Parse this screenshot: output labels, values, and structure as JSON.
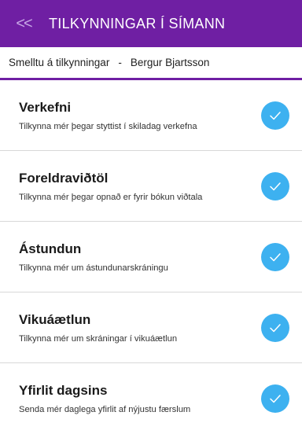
{
  "header": {
    "back_glyph": "<<",
    "title": "TILKYNNINGAR Í SÍMANN"
  },
  "subheader": {
    "instruction": "Smelltu á tilkynningar",
    "separator": "-",
    "user_name": "Bergur Bjartsson"
  },
  "colors": {
    "brand": "#6f1fa3",
    "check": "#3db1f0"
  },
  "items": [
    {
      "title": "Verkefni",
      "description": "Tilkynna mér þegar styttist í skiladag verkefna",
      "checked": true
    },
    {
      "title": "Foreldraviðtöl",
      "description": "Tilkynna mér þegar opnað er fyrir bókun viðtala",
      "checked": true
    },
    {
      "title": "Ástundun",
      "description": "Tilkynna mér um ástundunarskráningu",
      "checked": true
    },
    {
      "title": "Vikuáætlun",
      "description": "Tilkynna mér um skráningar í vikuáætlun",
      "checked": true
    },
    {
      "title": "Yfirlit dagsins",
      "description": "Senda mér daglega yfirlit af nýjustu færslum",
      "checked": true
    }
  ]
}
